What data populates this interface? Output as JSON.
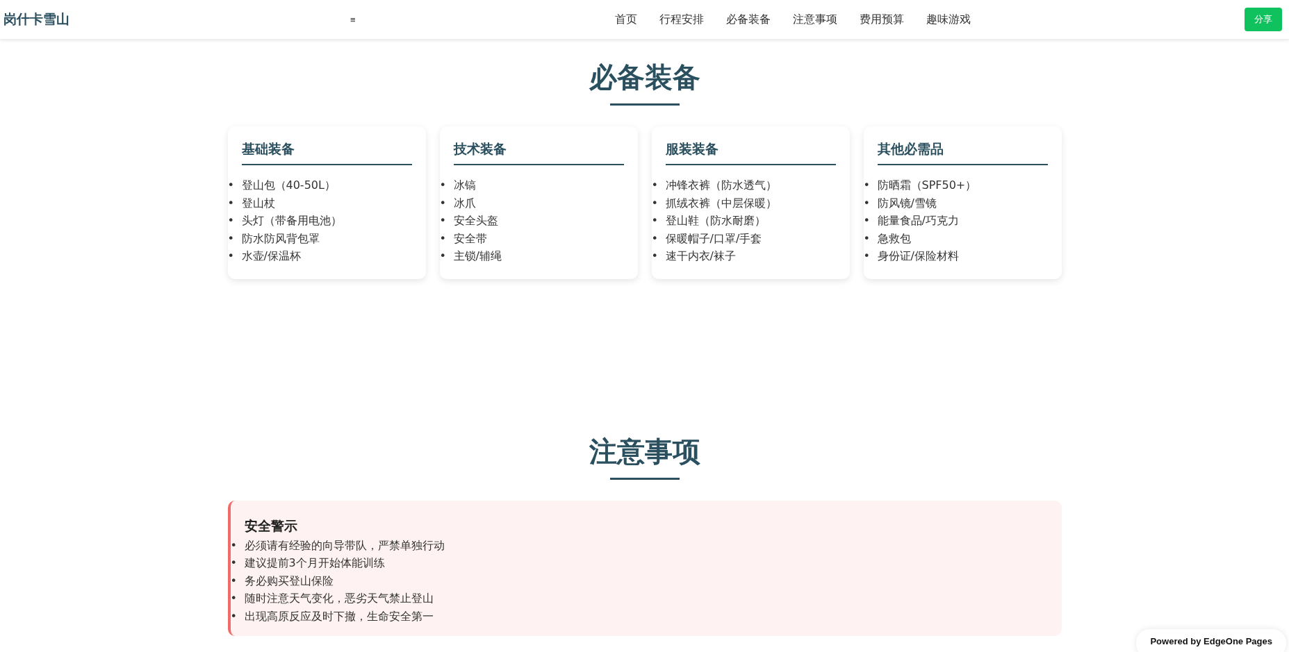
{
  "header": {
    "logo": "岗什卡雪山",
    "menu_toggle": "≡",
    "nav": [
      "首页",
      "行程安排",
      "必备装备",
      "注意事项",
      "费用预算",
      "趣味游戏"
    ],
    "share_button": "分享"
  },
  "bullet": "•",
  "equipment": {
    "title": "必备装备",
    "cards": [
      {
        "title": "基础装备",
        "items": [
          "登山包（40-50L）",
          "登山杖",
          "头灯（带备用电池）",
          "防水防风背包罩",
          "水壶/保温杯"
        ]
      },
      {
        "title": "技术装备",
        "items": [
          "冰镐",
          "冰爪",
          "安全头盔",
          "安全带",
          "主锁/辅绳"
        ]
      },
      {
        "title": "服装装备",
        "items": [
          "冲锋衣裤（防水透气）",
          "抓绒衣裤（中层保暖）",
          "登山鞋（防水耐磨）",
          "保暖帽子/口罩/手套",
          "速干内衣/袜子"
        ]
      },
      {
        "title": "其他必需品",
        "items": [
          "防晒霜（SPF50+）",
          "防风镜/雪镜",
          "能量食品/巧克力",
          "急救包",
          "身份证/保险材料"
        ]
      }
    ]
  },
  "notes": {
    "title": "注意事项",
    "warning": {
      "title": "安全警示",
      "items": [
        "必须请有经验的向导带队，严禁单独行动",
        "建议提前3个月开始体能训练",
        "务必购买登山保险",
        "随时注意天气变化，恶劣天气禁止登山",
        "出现高原反应及时下撤，生命安全第一"
      ]
    }
  },
  "badge": "Powered by EdgeOne Pages"
}
